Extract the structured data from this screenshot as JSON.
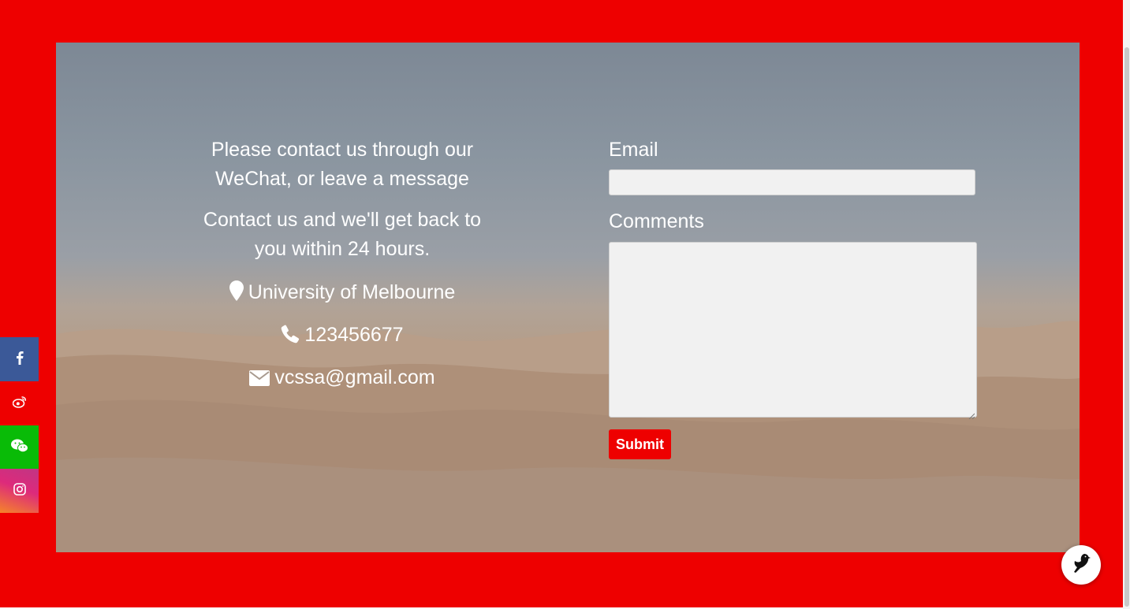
{
  "contact": {
    "intro_line_1": "Please contact us through our WeChat, or leave a message",
    "intro_line_2": "Contact us and we'll get back to you within 24 hours.",
    "location": "University of Melbourne",
    "phone": "123456677",
    "email": "vcssa@gmail.com"
  },
  "form": {
    "email_label": "Email",
    "email_value": "",
    "comments_label": "Comments",
    "comments_value": "",
    "submit_label": "Submit"
  },
  "social": [
    {
      "name": "facebook",
      "icon": "facebook-icon",
      "color": "#3b5998"
    },
    {
      "name": "weibo",
      "icon": "weibo-icon",
      "color": "#ee0000"
    },
    {
      "name": "wechat",
      "icon": "wechat-icon",
      "color": "#09bb07"
    },
    {
      "name": "instagram",
      "icon": "instagram-icon",
      "color": "#dd2a7b"
    }
  ],
  "colors": {
    "accent": "#ee0000",
    "text_on_image": "#ffffff",
    "input_background": "#f1f1f1"
  }
}
